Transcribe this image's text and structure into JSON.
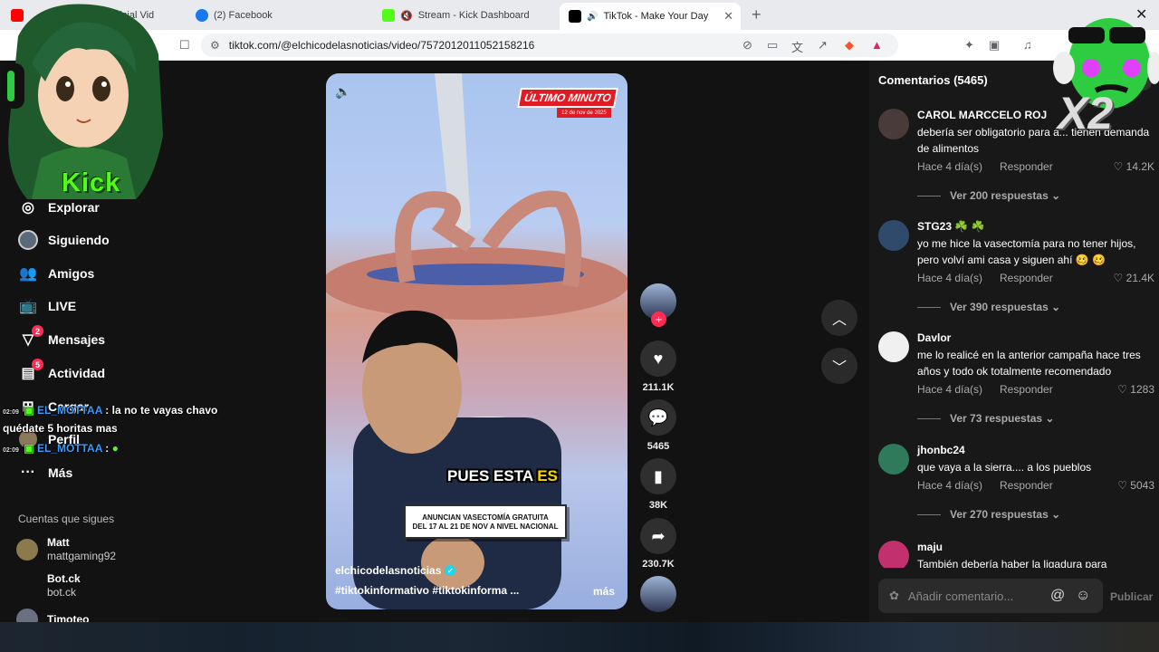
{
  "tabs": [
    {
      "label": "Official Vid",
      "favicon": "youtube-icon"
    },
    {
      "label": "(2) Facebook",
      "favicon": "facebook-icon"
    },
    {
      "label": "Stream - Kick Dashboard",
      "favicon": "kick-icon"
    },
    {
      "label": "TikTok - Make Your Day",
      "favicon": "tiktok-icon",
      "active": true
    }
  ],
  "address": {
    "url": "tiktok.com/@elchicodelasnoticias/video/7572012011052158216"
  },
  "sidebar": {
    "items": [
      {
        "label": "Explorar",
        "icon": "compass-icon"
      },
      {
        "label": "Siguiendo",
        "icon": "following-avatar-icon"
      },
      {
        "label": "Amigos",
        "icon": "friends-icon"
      },
      {
        "label": "LIVE",
        "icon": "live-icon"
      },
      {
        "label": "Mensajes",
        "icon": "messages-icon",
        "badge": "2"
      },
      {
        "label": "Actividad",
        "icon": "activity-icon",
        "badge": "5"
      },
      {
        "label": "Cargar",
        "icon": "upload-icon"
      },
      {
        "label": "Perfil",
        "icon": "profile-icon"
      },
      {
        "label": "Más",
        "icon": "more-icon"
      }
    ],
    "following_title": "Cuentas que sigues",
    "following": [
      {
        "name": "Matt",
        "username": "mattgaming92"
      },
      {
        "name": "Bot.ck",
        "username": "bot.ck"
      },
      {
        "name": "Timoteo",
        "username": ""
      }
    ]
  },
  "overlay": {
    "kick_label": "Kick",
    "multiplier": "X2",
    "chat": [
      {
        "time": "02:09",
        "user": "EL_MOTTAA",
        "message": ": la no te vayas chavo"
      },
      {
        "time": "",
        "user": "",
        "message": "quédate 5 horitas mas"
      },
      {
        "time": "02:09",
        "user": "EL_MOTTAA",
        "message": ":"
      }
    ]
  },
  "video": {
    "breaking_label": "ÚLTIMO MINUTO",
    "breaking_date": "12 de nov de 2025",
    "subtitle_white": "PUES ESTA ",
    "subtitle_yellow": "ES",
    "news_line1": "ANUNCIAN VASECTOMÍA GRATUITA",
    "news_line2": "DEL 17 AL 21 DE NOV A NIVEL NACIONAL",
    "author": "elchicodelasnoticias",
    "tags": "#tiktokinformativo  #tiktokinforma  ...",
    "more": "más"
  },
  "actions": {
    "likes": "211.1K",
    "comments": "5465",
    "saves": "38K",
    "shares": "230.7K"
  },
  "comments": {
    "title": "Comentarios (5465)",
    "input_placeholder": "Añadir comentario...",
    "publish_label": "Publicar",
    "reply_label": "Responder",
    "list": [
      {
        "user": "CAROL MARCCELO ROJ",
        "text": "debería ser obligatorio para a... tienen demanda de alimentos",
        "time": "Hace 4 día(s)",
        "likes": "14.2K",
        "replies": "Ver 200 respuestas",
        "avatar_color": "#4a3b3b"
      },
      {
        "user": "STG23 ☘️ ☘️",
        "text": "yo me hice la vasectomía para no tener hijos, pero volví ami casa y siguen ahí 🥴 🥴",
        "time": "Hace 4 día(s)",
        "likes": "21.4K",
        "replies": "Ver 390 respuestas",
        "avatar_color": "#2f4a6b"
      },
      {
        "user": "Davlor",
        "text": "me lo realicé en la anterior campaña hace tres años y todo ok totalmente recomendado",
        "time": "Hace 4 día(s)",
        "likes": "1283",
        "replies": "Ver 73 respuestas",
        "avatar_color": "#f0f0f0"
      },
      {
        "user": "jhonbc24",
        "text": "que vaya a la sierra.... a los pueblos",
        "time": "Hace 4 día(s)",
        "likes": "5043",
        "replies": "Ver 270 respuestas",
        "avatar_color": "#2e7a5a"
      },
      {
        "user": "maju",
        "text": "También debería haber la ligadura para",
        "time": "",
        "likes": "",
        "replies": "",
        "avatar_color": "#c2306d"
      }
    ]
  },
  "colors": {
    "accent": "#fe2c55",
    "kick_green": "#53fc18",
    "panel": "#181818"
  }
}
